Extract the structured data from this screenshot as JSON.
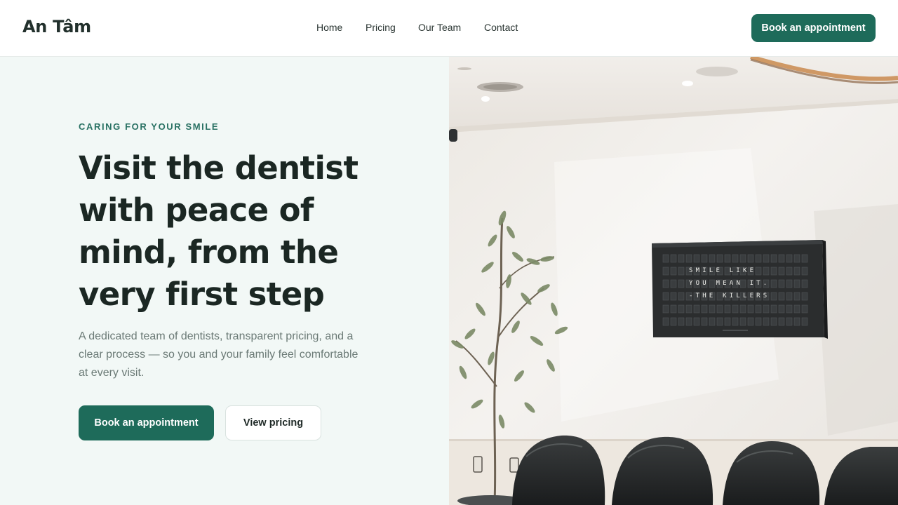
{
  "header": {
    "logo": "An Tâm",
    "nav": [
      "Home",
      "Pricing",
      "Our Team",
      "Contact"
    ],
    "cta_label": "Book an appointment"
  },
  "hero": {
    "eyebrow": "CARING FOR YOUR SMILE",
    "headline_lines": [
      "Visit the dentist",
      "with peace of",
      "mind, from the",
      "very first step"
    ],
    "subtext_lines": [
      "A dedicated team of dentists, transparent pricing, and a",
      "clear process — so you and your family feel comfortable",
      "at every visit."
    ],
    "primary_button": "Book an appointment",
    "secondary_button": "View pricing"
  },
  "image": {
    "board_lines": [
      "SMILE LIKE",
      "YOU MEAN IT.",
      "-THE KILLERS"
    ]
  },
  "colors": {
    "accent": "#1e6b5a",
    "eyebrow": "#2a7264",
    "hero_bg": "#f2f8f6",
    "headline": "#1b2723",
    "body_text": "#6b7a76"
  }
}
